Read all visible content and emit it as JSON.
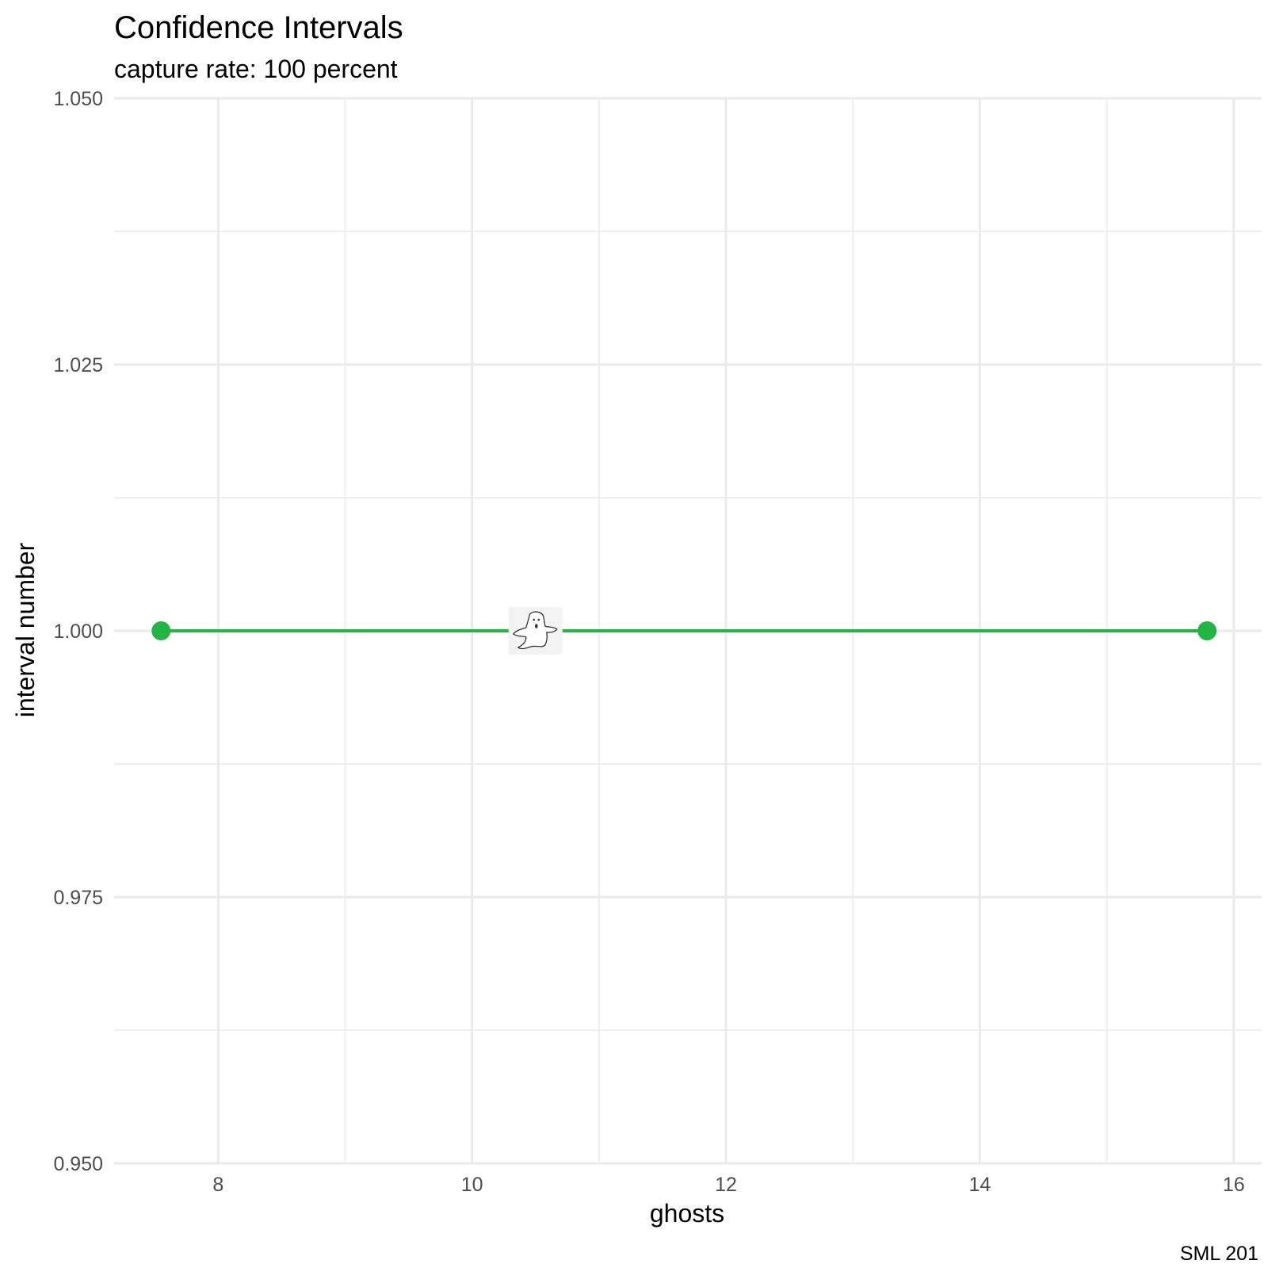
{
  "chart_data": {
    "type": "line",
    "title": "Confidence Intervals",
    "subtitle": "capture rate: 100 percent",
    "xlabel": "ghosts",
    "ylabel": "interval number",
    "caption": "SML 201",
    "xlim": [
      7.18,
      16.22
    ],
    "ylim": [
      0.95,
      1.05
    ],
    "x_ticks": [
      8,
      10,
      12,
      14,
      16
    ],
    "x_tick_labels": [
      "8",
      "10",
      "12",
      "14",
      "16"
    ],
    "x_minor_ticks": [
      9,
      11,
      13,
      15
    ],
    "y_ticks": [
      0.95,
      0.975,
      1.0,
      1.025,
      1.05
    ],
    "y_tick_labels": [
      "0.950",
      "0.975",
      "1.000",
      "1.025",
      "1.050"
    ],
    "y_minor_ticks": [
      0.9625,
      0.9875,
      1.0125,
      1.0375
    ],
    "grid": true,
    "intervals": [
      {
        "interval": 1,
        "lower": 7.55,
        "upper": 15.79,
        "estimate": 10.5,
        "color": "#22b545",
        "estimate_marker": "ghost-icon"
      }
    ]
  }
}
